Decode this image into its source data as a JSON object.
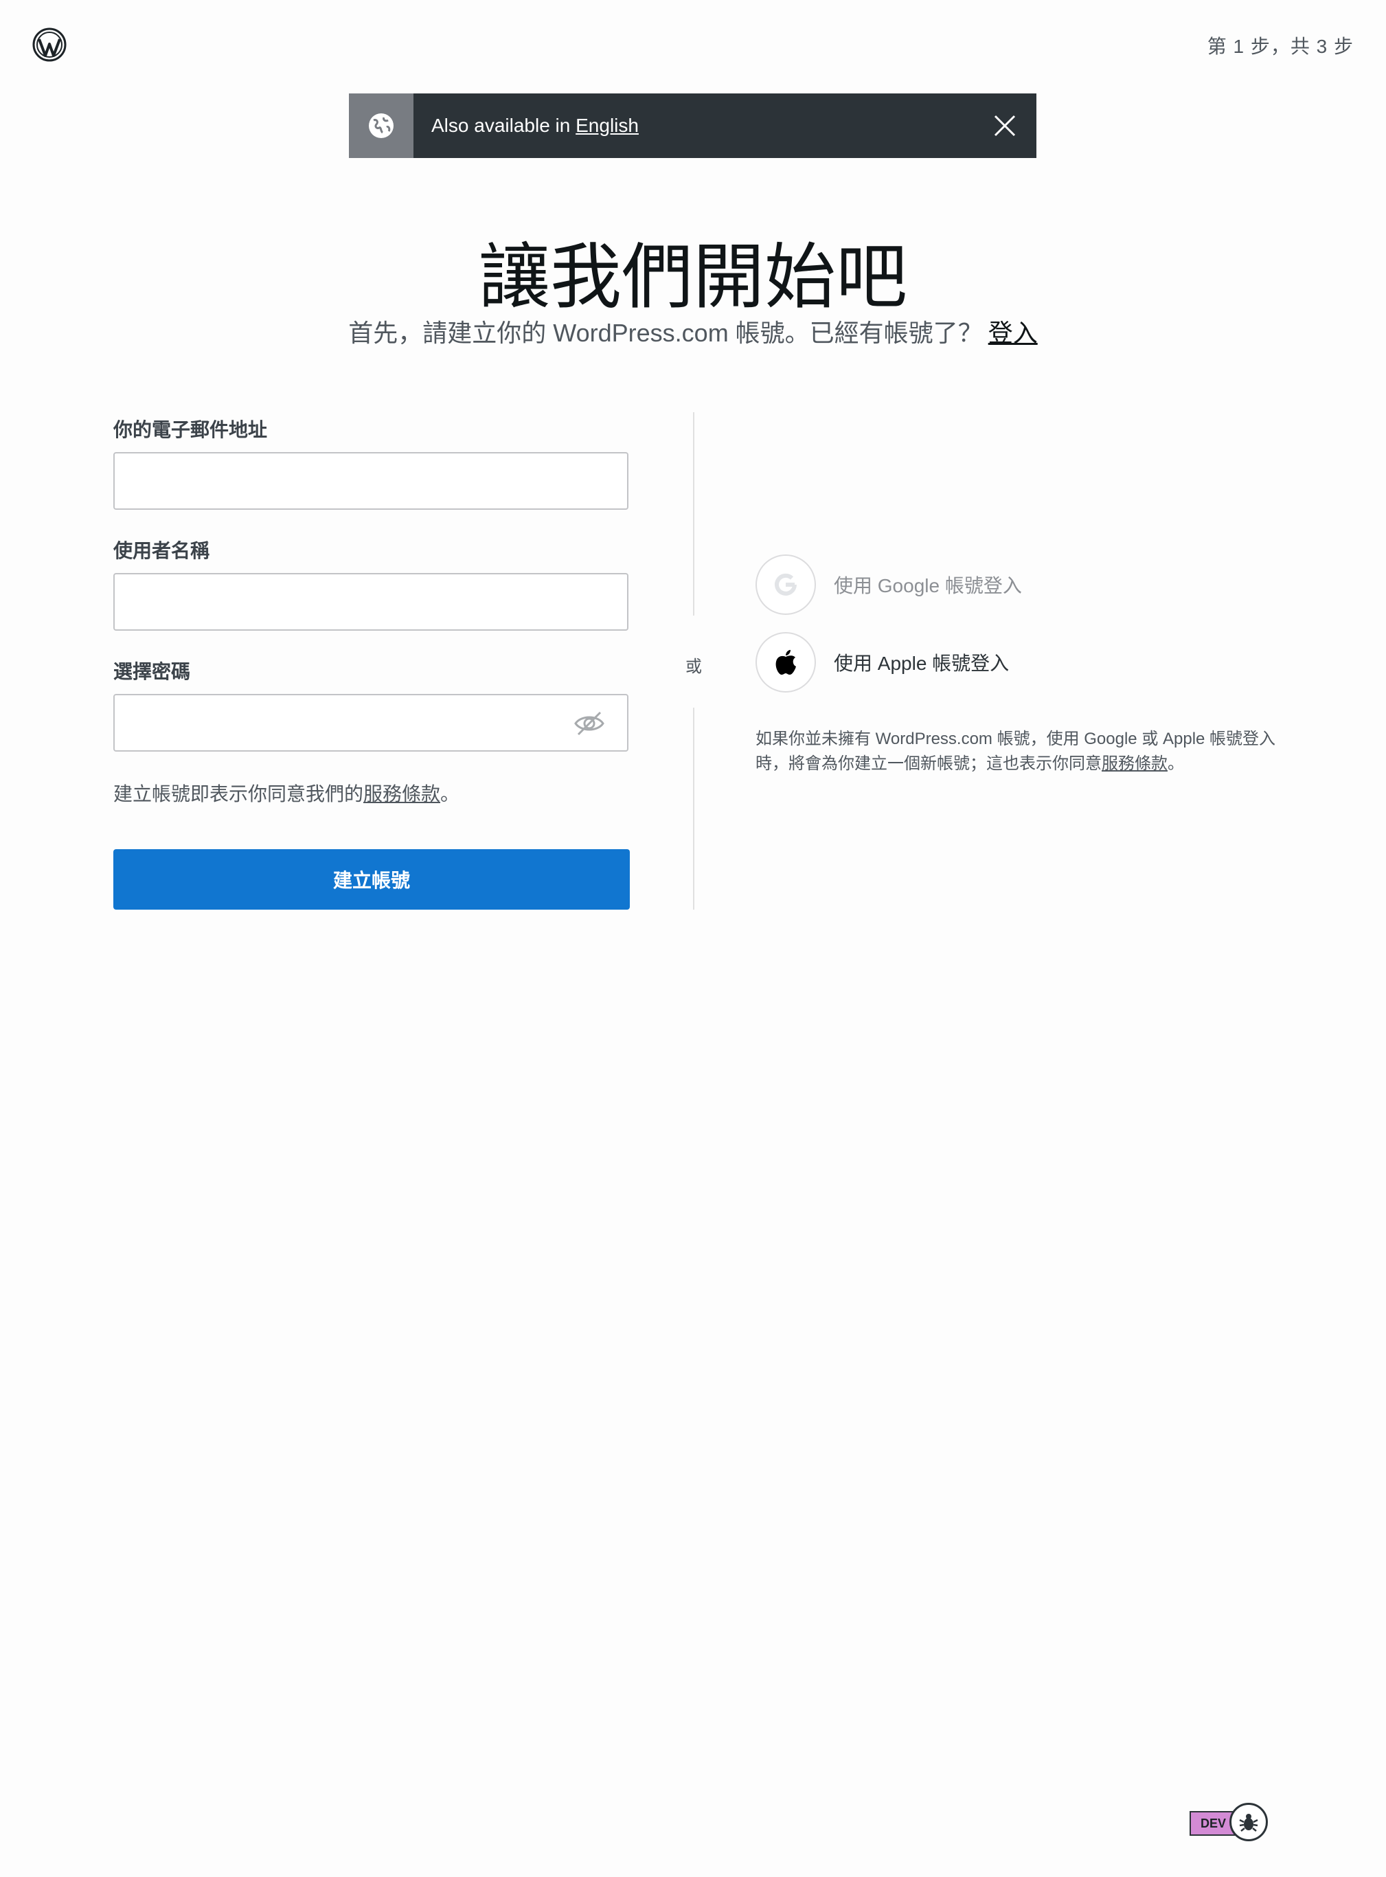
{
  "header": {
    "step_indicator": "第 1 步，共 3 步"
  },
  "notice": {
    "prefix": "Also available in ",
    "link": "English"
  },
  "hero": {
    "title": "讓我們開始吧",
    "subtitle": "首先，請建立你的 WordPress.com 帳號。已經有帳號了？",
    "login_link": "登入"
  },
  "form": {
    "email_label": "你的電子郵件地址",
    "email_value": "",
    "username_label": "使用者名稱",
    "username_value": "",
    "password_label": "選擇密碼",
    "password_value": "",
    "terms_prefix": "建立帳號即表示你同意我們的",
    "terms_link": "服務條款",
    "terms_suffix": "。",
    "submit_label": "建立帳號"
  },
  "separator": {
    "or": "或"
  },
  "social": {
    "google_label": "使用 Google 帳號登入",
    "apple_label": "使用 Apple 帳號登入",
    "note_prefix": "如果你並未擁有 WordPress.com 帳號，使用 Google 或 Apple 帳號登入時，將會為你建立一個新帳號；這也表示你同意",
    "note_link": "服務條款",
    "note_suffix": "。"
  },
  "dev": {
    "badge": "DEV"
  },
  "colors": {
    "primary": "#1176d0",
    "notice_bg": "#2c3338",
    "dev_badge": "#d38bd5"
  },
  "icons": [
    "wordpress-logo-icon",
    "globe-icon",
    "close-icon",
    "eye-slash-icon",
    "google-icon",
    "apple-icon",
    "bug-icon"
  ]
}
